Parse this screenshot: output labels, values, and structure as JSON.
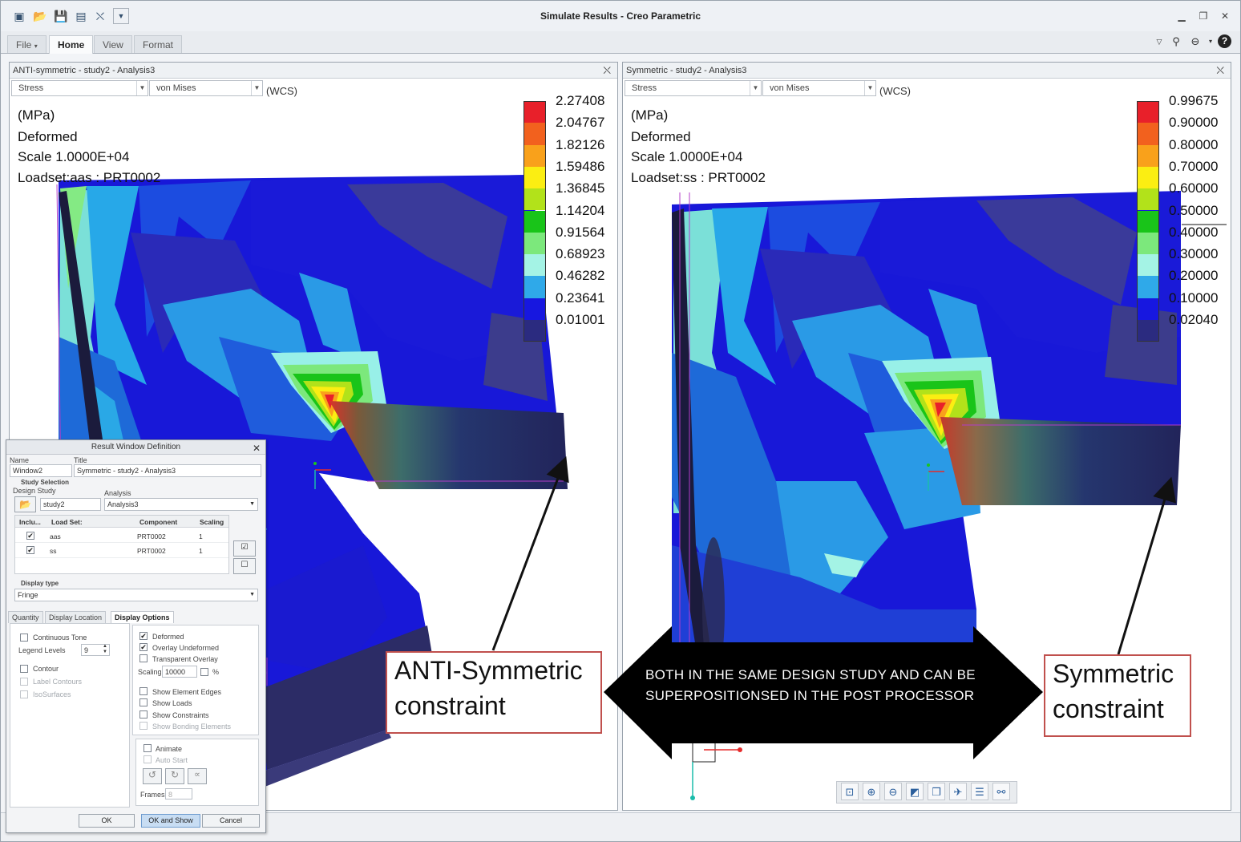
{
  "window": {
    "title": "Simulate Results - Creo Parametric",
    "quick_access_icons": [
      "new-window-icon",
      "open-icon",
      "save-icon",
      "save-as-icon",
      "close-icon",
      "dropdown-icon"
    ]
  },
  "ribbon": {
    "tabs": [
      {
        "label": "File",
        "has_menu": true
      },
      {
        "label": "Home",
        "active": true
      },
      {
        "label": "View"
      },
      {
        "label": "Format"
      }
    ],
    "right_icons": [
      "ribbon-collapse-icon",
      "search-icon",
      "community-icon",
      "help-icon"
    ]
  },
  "left_panel": {
    "title": "ANTI-symmetric - study2 - Analysis3",
    "quantity": "Stress",
    "component": "von Mises",
    "csys": "(WCS)",
    "info": [
      "(MPa)",
      "Deformed",
      "Scale  1.0000E+04",
      "Loadset:aas :  PRT0002"
    ],
    "legend": [
      "2.27408",
      "2.04767",
      "1.82126",
      "1.59486",
      "1.36845",
      "1.14204",
      "0.91564",
      "0.68923",
      "0.46282",
      "0.23641",
      "0.01001"
    ]
  },
  "right_panel": {
    "title": "Symmetric - study2 - Analysis3",
    "quantity": "Stress",
    "component": "von Mises",
    "csys": "(WCS)",
    "info": [
      "(MPa)",
      "Deformed",
      "Scale  1.0000E+04",
      "Loadset:ss :  PRT0002"
    ],
    "legend": [
      "0.99675",
      "0.90000",
      "0.80000",
      "0.70000",
      "0.60000",
      "0.50000",
      "0.40000",
      "0.30000",
      "0.20000",
      "0.10000",
      "0.02040"
    ]
  },
  "legend_colors": [
    "#e8202a",
    "#f2611e",
    "#f9a11b",
    "#fbee12",
    "#b2e21a",
    "#19c419",
    "#7ce87c",
    "#a4f3e5",
    "#2fa9e9",
    "#1717e0",
    "#2b2b80"
  ],
  "annotations": {
    "anti_label": "ANTI-Symmetric constraint",
    "sym_label": "Symmetric constraint",
    "both_text_line1": "BOTH IN THE SAME DESIGN STUDY AND CAN BE",
    "both_text_line2": "SUPERPOSITIONSED  IN THE POST PROCESSOR"
  },
  "axis_label_x": "x",
  "bottom_toolbar_icons": [
    "refit-icon",
    "zoom-in-icon",
    "zoom-out-icon",
    "repaint-icon",
    "view-manager-icon",
    "spin-center-icon",
    "display-style-icon",
    "datum-display-icon"
  ],
  "dialog": {
    "title": "Result Window Definition",
    "name_label": "Name",
    "name_value": "Window2",
    "title_label": "Title",
    "title_value": "Symmetric - study2 - Analysis3",
    "study_selection": "Study Selection",
    "design_study_label": "Design Study",
    "design_study_value": "study2",
    "analysis_label": "Analysis",
    "analysis_value": "Analysis3",
    "table_headers": [
      "Inclu...",
      "Load Set:",
      "Component",
      "Scaling"
    ],
    "table_rows": [
      {
        "included": true,
        "load_set": "aas",
        "component": "PRT0002",
        "scaling": "1"
      },
      {
        "included": true,
        "load_set": "ss",
        "component": "PRT0002",
        "scaling": "1"
      }
    ],
    "display_type_label": "Display type",
    "display_type_value": "Fringe",
    "tabs": [
      "Quantity",
      "Display Location",
      "Display Options"
    ],
    "active_tab": "Display Options",
    "continuous_tone": "Continuous Tone",
    "legend_levels_label": "Legend Levels",
    "legend_levels_value": "9",
    "contour": "Contour",
    "label_contours": "Label Contours",
    "isosurfaces": "IsoSurfaces",
    "deformed": "Deformed",
    "overlay_undeformed": "Overlay Undeformed",
    "transparent_overlay": "Transparent Overlay",
    "scaling_label": "Scaling",
    "scaling_value": "10000",
    "percent": "%",
    "show_element_edges": "Show Element Edges",
    "show_loads": "Show Loads",
    "show_constraints": "Show Constraints",
    "show_bonding_elements": "Show Bonding Elements",
    "animate": "Animate",
    "auto_start": "Auto Start",
    "frames_label": "Frames",
    "frames_value": "8",
    "ok": "OK",
    "ok_and_show": "OK and Show",
    "cancel": "Cancel"
  }
}
